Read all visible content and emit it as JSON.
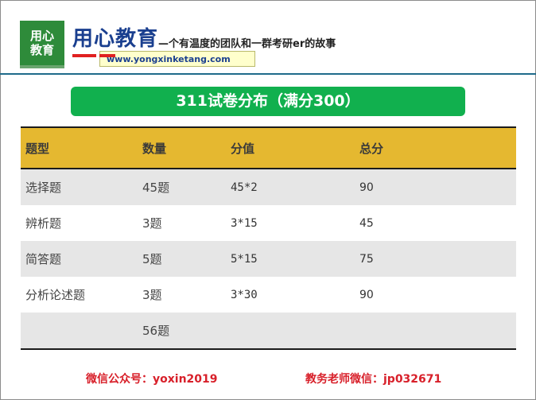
{
  "brand": {
    "logo_line1": "用心",
    "logo_line2": "教育",
    "name": "用心教育",
    "slogan": "—个有温度的团队和一群考研er的故事",
    "url": "www.yongxinketang.com"
  },
  "title": "311试卷分布（满分300）",
  "table": {
    "headers": [
      "题型",
      "数量",
      "分值",
      "总分"
    ],
    "rows": [
      [
        "选择题",
        "45题",
        "45*2",
        "90"
      ],
      [
        "辨析题",
        "3题",
        "3*15",
        "45"
      ],
      [
        "简答题",
        "5题",
        "5*15",
        "75"
      ],
      [
        "分析论述题",
        "3题",
        "3*30",
        "90"
      ],
      [
        "",
        "56题",
        "",
        ""
      ]
    ]
  },
  "footer": {
    "wechat_public": "微信公众号：yoxin2019",
    "teacher_wechat": "教务老师微信：jp032671"
  }
}
